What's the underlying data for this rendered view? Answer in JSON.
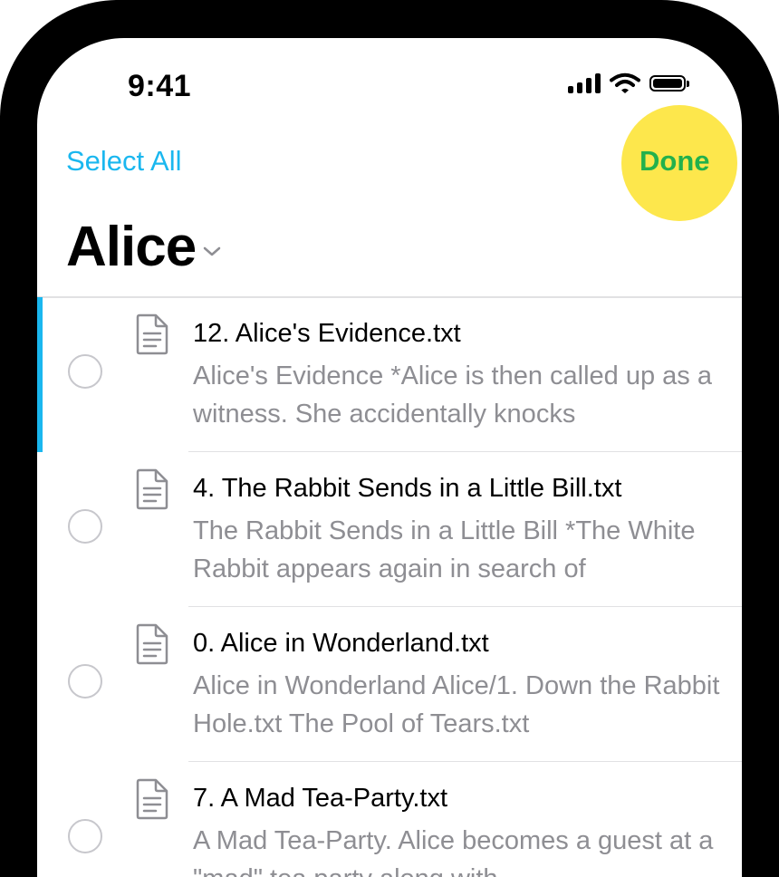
{
  "status_bar": {
    "time": "9:41"
  },
  "nav": {
    "select_all_label": "Select All",
    "done_label": "Done"
  },
  "header": {
    "title": "Alice"
  },
  "files": [
    {
      "title": "12. Alice's Evidence.txt",
      "preview": "Alice's Evidence *Alice is then called up as a witness. She accidentally knocks",
      "active": true
    },
    {
      "title": "4. The Rabbit Sends in a Little Bill.txt",
      "preview": "The Rabbit Sends in a Little Bill *The White Rabbit appears again in search of",
      "active": false
    },
    {
      "title": "0. Alice in Wonderland.txt",
      "preview": "Alice in Wonderland Alice/1. Down the Rabbit Hole.txt The Pool of Tears.txt",
      "active": false
    },
    {
      "title": "7. A Mad Tea-Party.txt",
      "preview": "A Mad Tea-Party. Alice becomes a guest at a \"mad\" tea party along with",
      "active": false
    }
  ],
  "colors": {
    "accent": "#1ab7ef",
    "done_text": "#22b14c",
    "done_highlight": "#fde74c",
    "secondary_text": "#8e8e93"
  },
  "icons": {
    "file": "document-icon",
    "title_chevron": "chevron-down-icon",
    "radio": "radio-circle"
  }
}
